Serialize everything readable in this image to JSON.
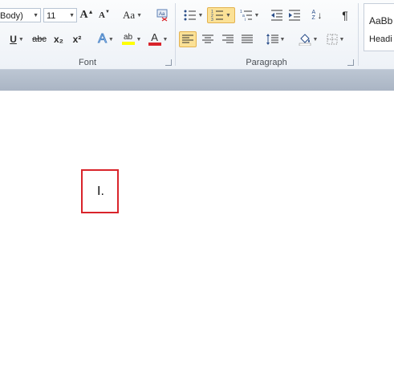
{
  "font_group": {
    "font_name": "Body)",
    "font_size": "11",
    "grow_font": "A",
    "shrink_font": "A",
    "change_case": "Aa",
    "underline": "U",
    "strikethrough": "abc",
    "subscript": "x₂",
    "superscript": "x²",
    "text_effects": "A",
    "highlight": "ab",
    "font_color": "A",
    "label": "Font",
    "highlight_color": "#ffff00",
    "font_color_value": "#d9242b"
  },
  "paragraph_group": {
    "show_marks": "¶",
    "sort": "AZ",
    "label": "Paragraph"
  },
  "styles_group": {
    "normal_preview": "AaBb",
    "heading_preview": "Headi"
  },
  "document": {
    "list_number": "I."
  }
}
